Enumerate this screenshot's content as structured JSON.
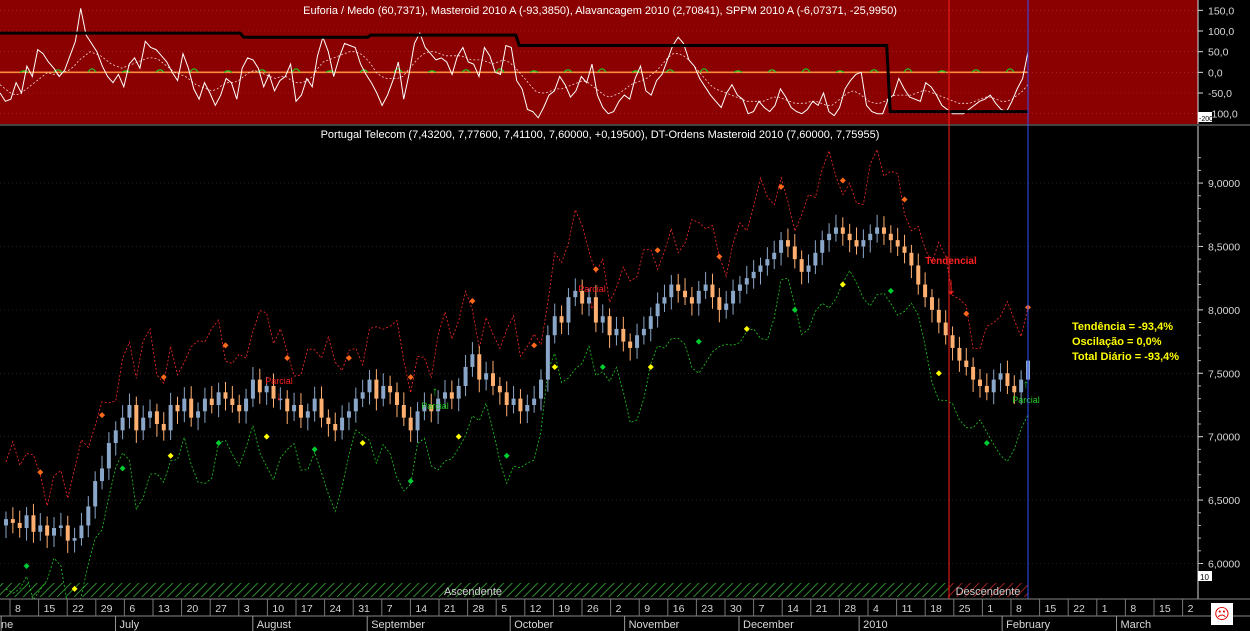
{
  "chart_data": [
    {
      "type": "line",
      "title": "Euforia / Medo (60,7371), Masteroid 2010 A (-93,3850), Alavancagem 2010 (2,70841), SPPM 2010 A (-6,07371, -25,9950)",
      "ylim": [
        -125,
        175
      ],
      "yticks": [
        "150,0",
        "100,0",
        "50,0",
        "0,0",
        "-50,0",
        "-100,0"
      ],
      "ytick_values": [
        150,
        100,
        50,
        0,
        -50,
        -100
      ],
      "corner_label": "-200",
      "background": "#8b0000",
      "series": [
        {
          "role": "oscillator",
          "color": "#ffffff",
          "values": [
            -50,
            -70,
            -65,
            -25,
            -50,
            15,
            -10,
            55,
            45,
            25,
            10,
            -10,
            5,
            40,
            75,
            155,
            90,
            70,
            50,
            15,
            -10,
            -25,
            -5,
            -35,
            20,
            35,
            10,
            75,
            60,
            55,
            40,
            25,
            0,
            -20,
            45,
            10,
            -40,
            -65,
            -25,
            -50,
            -80,
            -55,
            -15,
            -25,
            -65,
            10,
            35,
            30,
            10,
            -35,
            -5,
            -45,
            -20,
            -10,
            20,
            -70,
            -55,
            -15,
            -35,
            40,
            85,
            50,
            -10,
            35,
            70,
            65,
            60,
            20,
            -5,
            -25,
            -50,
            -80,
            -55,
            -20,
            25,
            -65,
            -5,
            70,
            95,
            60,
            45,
            30,
            35,
            25,
            -5,
            40,
            60,
            25,
            20,
            -10,
            60,
            40,
            0,
            -5,
            65,
            60,
            -20,
            -40,
            -90,
            -95,
            -110,
            -85,
            -55,
            -45,
            -10,
            -30,
            -60,
            -45,
            -10,
            -25,
            20,
            -55,
            -85,
            -100,
            -95,
            -70,
            -55,
            -65,
            -15,
            15,
            -45,
            -55,
            -20,
            -5,
            30,
            65,
            85,
            70,
            30,
            15,
            -15,
            -35,
            -55,
            -70,
            -85,
            -50,
            -30,
            -55,
            -65,
            -100,
            -95,
            -70,
            -85,
            -95,
            -80,
            -40,
            -60,
            -85,
            -95,
            -100,
            -90,
            -70,
            -80,
            -50,
            -95,
            -105,
            -85,
            -40,
            -20,
            -5,
            0,
            -80,
            -95,
            -100,
            -100,
            -65,
            -55,
            -15,
            -40,
            -60,
            -65,
            -70,
            -25,
            -35,
            -55,
            -80,
            -90,
            -100,
            -100,
            -100,
            -90,
            -80,
            -70,
            -65,
            -55,
            -75,
            -90,
            -95,
            -70,
            -40,
            -15,
            50
          ]
        },
        {
          "role": "signal-dotted",
          "color": "#ffffff",
          "values": [
            -30,
            -40,
            -50,
            -55,
            -50,
            -40,
            -30,
            -20,
            -10,
            0,
            -5,
            -5,
            0,
            5,
            15,
            30,
            40,
            50,
            45,
            40,
            30,
            20,
            15,
            10,
            15,
            20,
            25,
            30,
            35,
            35,
            30,
            20,
            10,
            0,
            -5,
            -10,
            -20,
            -30,
            -35,
            -40,
            -45,
            -40,
            -30,
            -25,
            -25,
            -20,
            -10,
            0,
            5,
            0,
            -5,
            -10,
            -15,
            -10,
            -10,
            -20,
            -25,
            -25,
            -20,
            -10,
            10,
            25,
            30,
            35,
            40,
            45,
            50,
            50,
            45,
            35,
            20,
            0,
            -10,
            -15,
            -15,
            -15,
            -10,
            5,
            20,
            35,
            45,
            50,
            50,
            45,
            40,
            40,
            40,
            40,
            35,
            30,
            30,
            30,
            25,
            20,
            25,
            30,
            25,
            15,
            0,
            -15,
            -30,
            -45,
            -50,
            -50,
            -45,
            -40,
            -40,
            -35,
            -30,
            -25,
            -20,
            -25,
            -35,
            -45,
            -55,
            -60,
            -55,
            -50,
            -40,
            -30,
            -25,
            -20,
            -15,
            -5,
            5,
            20,
            35,
            45,
            45,
            40,
            30,
            15,
            0,
            -15,
            -30,
            -40,
            -45,
            -50,
            -55,
            -60,
            -65,
            -70,
            -70,
            -70,
            -70,
            -65,
            -60,
            -60,
            -65,
            -70,
            -75,
            -75,
            -75,
            -70,
            -70,
            -75,
            -80,
            -80,
            -70,
            -60,
            -50,
            -45,
            -50,
            -60,
            -70,
            -75,
            -75,
            -70,
            -60,
            -55,
            -55,
            -55,
            -55,
            -50,
            -45,
            -45,
            -50,
            -55,
            -60,
            -65,
            -70,
            -75,
            -75,
            -75,
            -70,
            -65,
            -60,
            -60,
            -65,
            -70,
            -70,
            -65,
            -55,
            -45,
            -30
          ]
        },
        {
          "role": "masteroid-step",
          "color": "#000000",
          "values": [
            95,
            95,
            95,
            95,
            95,
            95,
            95,
            95,
            95,
            95,
            95,
            95,
            95,
            95,
            95,
            95,
            95,
            95,
            95,
            95,
            95,
            95,
            95,
            95,
            95,
            95,
            95,
            95,
            95,
            95,
            95,
            95,
            95,
            95,
            95,
            95,
            95,
            95,
            95,
            95,
            95,
            95,
            95,
            95,
            95,
            95,
            95,
            95,
            95,
            95,
            95,
            95,
            95,
            95,
            95,
            95,
            95,
            95,
            95,
            95,
            95,
            95,
            95,
            95,
            95,
            95,
            95,
            95,
            95,
            85,
            85,
            85,
            85,
            85,
            85,
            85,
            85,
            85,
            85,
            85,
            85,
            85,
            85,
            85,
            85,
            85,
            85,
            85,
            85,
            85,
            85,
            85,
            85,
            85,
            85,
            85,
            85,
            85,
            85,
            85,
            85,
            85,
            85,
            85,
            85,
            90,
            90,
            90,
            90,
            90,
            90,
            90,
            90,
            90,
            90,
            90,
            90,
            90,
            90,
            90,
            90,
            90,
            90,
            90,
            90,
            90,
            90,
            90,
            90,
            90,
            90,
            90,
            90,
            90,
            90,
            90,
            90,
            90,
            90,
            90,
            90,
            90,
            90,
            90,
            90,
            90,
            90,
            65,
            65,
            65,
            65,
            65,
            65,
            65,
            65,
            65,
            65,
            65,
            65,
            65,
            65,
            65,
            65,
            65,
            65,
            65,
            65,
            65,
            65,
            65,
            65,
            65,
            65,
            65,
            65,
            65,
            65,
            65,
            65,
            65,
            65,
            65,
            65,
            65,
            65,
            65,
            65,
            65,
            65,
            65,
            65,
            65,
            65,
            65,
            65,
            65,
            65,
            65,
            65,
            65,
            65,
            65,
            65,
            65,
            65,
            65,
            65,
            65,
            65,
            65,
            65,
            65,
            65,
            65,
            65,
            65,
            65,
            65,
            65,
            65,
            65,
            65,
            65,
            65,
            65,
            65,
            65,
            65,
            65,
            65,
            65,
            65,
            65,
            65,
            65,
            65,
            65,
            65,
            65,
            65,
            65,
            65,
            65,
            65,
            65,
            65,
            65,
            65,
            65,
            65,
            65,
            65,
            -95,
            -95,
            -95,
            -95,
            -95,
            -95,
            -95,
            -95,
            -95,
            -95,
            -95,
            -95,
            -95,
            -95,
            -95,
            -95,
            -95,
            -95,
            -95,
            -95,
            -95,
            -95,
            -95,
            -95,
            -95,
            -95,
            -95,
            -95,
            -95,
            -95,
            -95,
            -95,
            -95,
            -95,
            -95,
            -95,
            -95,
            -95,
            -95,
            -95
          ]
        },
        {
          "role": "zero-line",
          "color": "#ff8c3c",
          "values": [
            0
          ]
        }
      ]
    },
    {
      "type": "candlestick",
      "title": "Portugal Telecom (7,43200, 7,77600, 7,41100, 7,60000, +0,19500), DT-Ordens Masteroid 2010 (7,60000, 7,75955)",
      "ylim": [
        5.72,
        9.45
      ],
      "yticks": [
        "9,0000",
        "8,5000",
        "8,0000",
        "7,5000",
        "7,0000",
        "6,5000",
        "6,0000"
      ],
      "ytick_values": [
        9.0,
        8.5,
        8.0,
        7.5,
        7.0,
        6.5,
        6.0
      ],
      "corner_label": "10",
      "up_color": "#8aa6c8",
      "down_color": "#ffb070",
      "close": [
        6.35,
        6.32,
        6.28,
        6.38,
        6.25,
        6.3,
        6.22,
        6.28,
        6.3,
        6.18,
        6.2,
        6.3,
        6.45,
        6.65,
        6.75,
        6.95,
        7.05,
        7.15,
        7.25,
        7.05,
        7.15,
        7.2,
        7.1,
        7.05,
        7.25,
        7.2,
        7.3,
        7.15,
        7.2,
        7.3,
        7.25,
        7.35,
        7.3,
        7.25,
        7.2,
        7.3,
        7.45,
        7.35,
        7.4,
        7.3,
        7.3,
        7.2,
        7.25,
        7.15,
        7.2,
        7.3,
        7.15,
        7.1,
        7.05,
        7.15,
        7.2,
        7.3,
        7.35,
        7.45,
        7.3,
        7.4,
        7.35,
        7.25,
        7.15,
        7.05,
        7.2,
        7.25,
        7.2,
        7.3,
        7.35,
        7.3,
        7.4,
        7.55,
        7.65,
        7.45,
        7.5,
        7.4,
        7.35,
        7.25,
        7.3,
        7.2,
        7.25,
        7.3,
        7.45,
        7.8,
        7.95,
        7.9,
        8.1,
        8.15,
        8.05,
        8.1,
        7.9,
        7.95,
        7.8,
        7.85,
        7.75,
        7.7,
        7.8,
        7.85,
        7.95,
        8.05,
        8.1,
        8.2,
        8.15,
        8.1,
        8.05,
        8.15,
        8.2,
        8.1,
        8.0,
        8.05,
        8.15,
        8.2,
        8.25,
        8.3,
        8.35,
        8.4,
        8.45,
        8.55,
        8.5,
        8.4,
        8.3,
        8.35,
        8.45,
        8.55,
        8.6,
        8.65,
        8.6,
        8.55,
        8.5,
        8.55,
        8.6,
        8.65,
        8.6,
        8.55,
        8.5,
        8.45,
        8.35,
        8.2,
        8.1,
        8.0,
        7.9,
        7.8,
        7.7,
        7.6,
        7.55,
        7.45,
        7.4,
        7.35,
        7.45,
        7.5,
        7.4,
        7.35,
        7.45,
        7.6
      ],
      "marker_green": "#00cc33",
      "marker_yellow": "#ffff00",
      "marker_orange": "#ff6a1a",
      "band_colors": {
        "upper": "#ff2a2a",
        "lower": "#22cc22"
      },
      "signals": [
        {
          "label": "Parcial",
          "color": "#ff2020",
          "arrow": "down"
        },
        {
          "label": "Parcial",
          "color": "#22cc22",
          "arrow": "up"
        },
        {
          "label": "Parcial",
          "color": "#ff2020",
          "arrow": "down"
        },
        {
          "label": "Tendencial",
          "color": "#ff2020",
          "arrow": "down"
        },
        {
          "label": "Parcial",
          "color": "#22cc22",
          "arrow": "up"
        }
      ],
      "annotations": [
        "Tendência = -93,4%",
        "Oscilação = 0,0%",
        "Total Diário = -93,4%"
      ],
      "phases": [
        "Ascendente",
        "Descendente"
      ]
    }
  ],
  "xaxis": {
    "day_labels": [
      "8",
      "15",
      "22",
      "29",
      "6",
      "13",
      "20",
      "27",
      "3",
      "10",
      "17",
      "24",
      "31",
      "7",
      "14",
      "21",
      "28",
      "5",
      "12",
      "19",
      "26",
      "2",
      "9",
      "16",
      "23",
      "30",
      "7",
      "14",
      "21",
      "28",
      "4",
      "11",
      "18",
      "25",
      "1",
      "8",
      "15",
      "22",
      "1",
      "8",
      "15",
      "2"
    ],
    "month_labels": [
      "ne",
      "July",
      "August",
      "September",
      "October",
      "November",
      "December",
      "2010",
      "February",
      "March"
    ]
  },
  "status_icon": "sad-face-icon"
}
